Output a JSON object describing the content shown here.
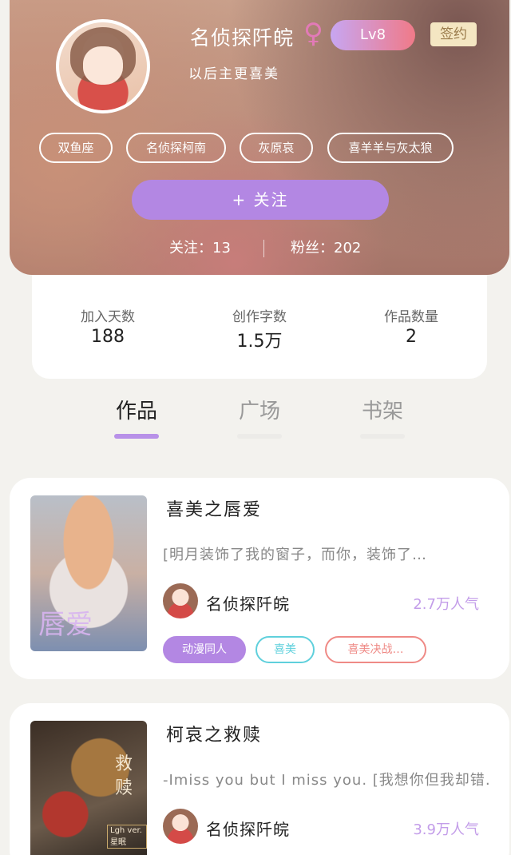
{
  "profile": {
    "username": "名侦探阡皖",
    "gender_symbol": "♀",
    "level": "Lv8",
    "sign_label": "签约",
    "motto": "以后主更喜美",
    "tags": [
      "双鱼座",
      "名侦探柯南",
      "灰原哀",
      "喜羊羊与灰太狼"
    ],
    "follow_button": "+ 关注",
    "following_label": "关注：13",
    "fans_label": "粉丝：202"
  },
  "stats": [
    {
      "label": "加入天数",
      "value": "188"
    },
    {
      "label": "创作字数",
      "value": "1.5万"
    },
    {
      "label": "作品数量",
      "value": "2"
    }
  ],
  "tabs": [
    {
      "label": "作品",
      "active": true
    },
    {
      "label": "广场",
      "active": false
    },
    {
      "label": "书架",
      "active": false
    }
  ],
  "works": [
    {
      "title": "喜美之唇爱",
      "cover_text": "唇爱",
      "description": "[明月装饰了我的窗子，而你，装饰了…",
      "author": "名侦探阡皖",
      "popularity": "2.7万人气",
      "chips": [
        {
          "label": "动漫同人",
          "style": "filled"
        },
        {
          "label": "喜美",
          "style": "cyan"
        },
        {
          "label": "喜美决战…",
          "style": "red"
        }
      ]
    },
    {
      "title": "柯哀之救赎",
      "cover_text": "救赎",
      "cover_ribbon": "Lgh ver.星眠",
      "description": "-Imiss you but I miss you. [我想你但我却错…",
      "author": "名侦探阡皖",
      "popularity": "3.9万人气"
    }
  ],
  "colors": {
    "accent": "#b387e3",
    "popularity": "#c39de9",
    "chip_cyan": "#5fd0dc",
    "chip_red": "#ef8a86"
  }
}
